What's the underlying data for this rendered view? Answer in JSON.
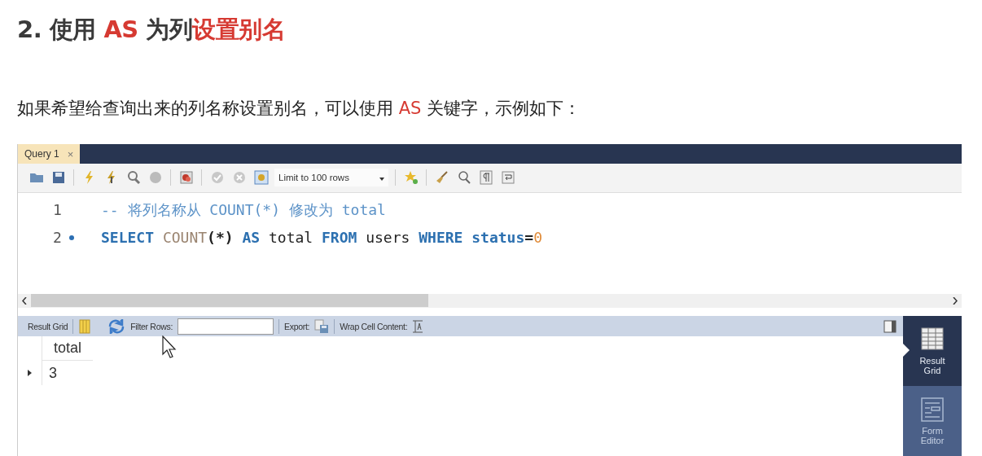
{
  "heading": [
    {
      "text": "2. 使用 ",
      "accent": false
    },
    {
      "text": "AS",
      "accent": true
    },
    {
      "text": " 为列",
      "accent": false
    },
    {
      "text": "设置别名",
      "accent": true
    }
  ],
  "intro": [
    {
      "text": "如果希望给查询出来的列名称设置别名，可以使用 ",
      "accent": false
    },
    {
      "text": "AS",
      "accent": true
    },
    {
      "text": " 关键字，示例如下：",
      "accent": false
    }
  ],
  "editor_tabs": [
    {
      "label": "Query 1",
      "close": "×",
      "selected": true
    }
  ],
  "toolbar": {
    "limit": "Limit to 100 rows"
  },
  "code_lines": [
    {
      "number": "1",
      "marker": false,
      "words": [
        [
          {
            "kind": "comment",
            "text": "-- 将列名称从 COUNT(*) 修改为 total"
          }
        ]
      ]
    },
    {
      "number": "2",
      "marker": true,
      "words": [
        [
          {
            "kind": "keyword",
            "text": "SELECT"
          }
        ],
        [
          {
            "kind": "function",
            "text": "COUNT"
          },
          {
            "kind": "punct",
            "text": "(*)"
          }
        ],
        [
          {
            "kind": "keyword",
            "text": "AS"
          }
        ],
        [
          {
            "kind": "plain",
            "text": "total"
          }
        ],
        [
          {
            "kind": "keyword",
            "text": "FROM"
          }
        ],
        [
          {
            "kind": "plain",
            "text": "users"
          }
        ],
        [
          {
            "kind": "keyword",
            "text": "WHERE"
          }
        ],
        [
          {
            "kind": "keyword",
            "text": "status"
          },
          {
            "kind": "punct",
            "text": "="
          },
          {
            "kind": "number",
            "text": "0"
          }
        ]
      ]
    }
  ],
  "result_toolbar": {
    "result_grid": "Result Grid",
    "filter_label": "Filter Rows:",
    "export_label": "Export:",
    "wrap_label": "Wrap Cell Content:"
  },
  "result_table": {
    "columns": [
      "total"
    ],
    "rows": [
      [
        "3"
      ]
    ]
  },
  "side_tabs": [
    {
      "label": "Result Grid",
      "selected": true
    },
    {
      "label": "Form Editor",
      "selected": false
    }
  ]
}
